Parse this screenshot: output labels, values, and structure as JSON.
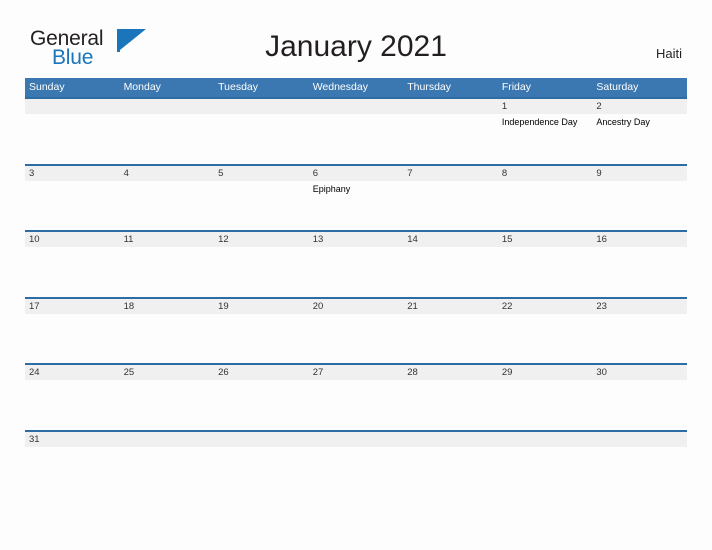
{
  "logo": {
    "word_one": "General",
    "word_two": "Blue",
    "flag_icon": "flag-triangle-icon"
  },
  "header": {
    "title": "January 2021",
    "country": "Haiti"
  },
  "colors": {
    "header_blue": "#3b77b0",
    "row_border_blue": "#2e6da4",
    "band_gray": "#f0f0f0",
    "logo_blue": "#1b75bb",
    "text_dark": "#231f20"
  },
  "calendar": {
    "weekdays": [
      "Sunday",
      "Monday",
      "Tuesday",
      "Wednesday",
      "Thursday",
      "Friday",
      "Saturday"
    ],
    "weeks": [
      [
        {
          "day": "",
          "event": ""
        },
        {
          "day": "",
          "event": ""
        },
        {
          "day": "",
          "event": ""
        },
        {
          "day": "",
          "event": ""
        },
        {
          "day": "",
          "event": ""
        },
        {
          "day": "1",
          "event": "Independence Day"
        },
        {
          "day": "2",
          "event": "Ancestry Day"
        }
      ],
      [
        {
          "day": "3",
          "event": ""
        },
        {
          "day": "4",
          "event": ""
        },
        {
          "day": "5",
          "event": ""
        },
        {
          "day": "6",
          "event": "Epiphany"
        },
        {
          "day": "7",
          "event": ""
        },
        {
          "day": "8",
          "event": ""
        },
        {
          "day": "9",
          "event": ""
        }
      ],
      [
        {
          "day": "10",
          "event": ""
        },
        {
          "day": "11",
          "event": ""
        },
        {
          "day": "12",
          "event": ""
        },
        {
          "day": "13",
          "event": ""
        },
        {
          "day": "14",
          "event": ""
        },
        {
          "day": "15",
          "event": ""
        },
        {
          "day": "16",
          "event": ""
        }
      ],
      [
        {
          "day": "17",
          "event": ""
        },
        {
          "day": "18",
          "event": ""
        },
        {
          "day": "19",
          "event": ""
        },
        {
          "day": "20",
          "event": ""
        },
        {
          "day": "21",
          "event": ""
        },
        {
          "day": "22",
          "event": ""
        },
        {
          "day": "23",
          "event": ""
        }
      ],
      [
        {
          "day": "24",
          "event": ""
        },
        {
          "day": "25",
          "event": ""
        },
        {
          "day": "26",
          "event": ""
        },
        {
          "day": "27",
          "event": ""
        },
        {
          "day": "28",
          "event": ""
        },
        {
          "day": "29",
          "event": ""
        },
        {
          "day": "30",
          "event": ""
        }
      ],
      [
        {
          "day": "31",
          "event": ""
        },
        {
          "day": "",
          "event": ""
        },
        {
          "day": "",
          "event": ""
        },
        {
          "day": "",
          "event": ""
        },
        {
          "day": "",
          "event": ""
        },
        {
          "day": "",
          "event": ""
        },
        {
          "day": "",
          "event": ""
        }
      ]
    ]
  }
}
